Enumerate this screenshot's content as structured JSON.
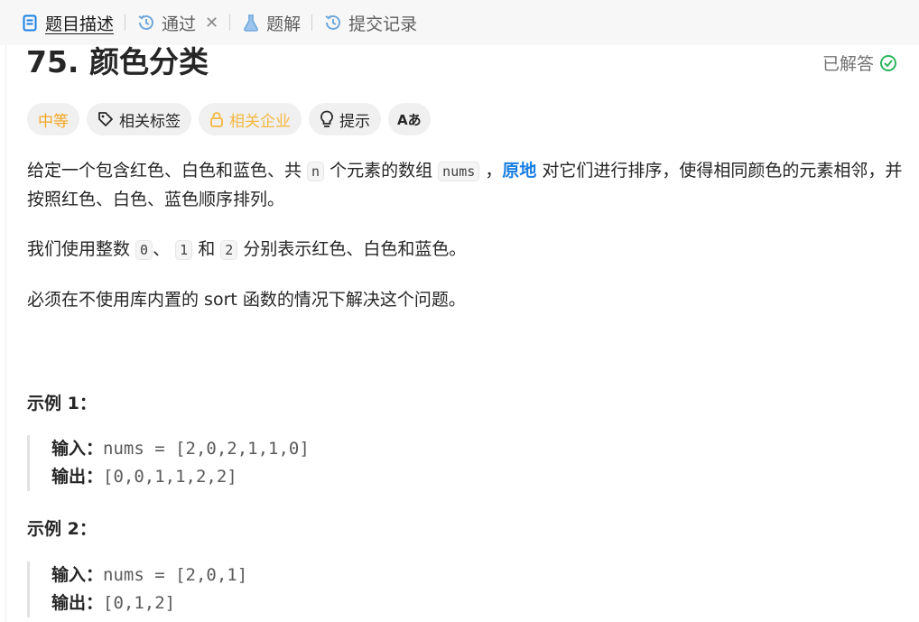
{
  "tabs": [
    {
      "label": "题目描述",
      "icon": "document-icon",
      "active": true
    },
    {
      "label": "通过",
      "icon": "history-icon",
      "closable": true
    },
    {
      "label": "题解",
      "icon": "flask-icon"
    },
    {
      "label": "提交记录",
      "icon": "history-icon"
    }
  ],
  "problem": {
    "title": "75. 颜色分类",
    "status": "已解答"
  },
  "chips": {
    "difficulty": "中等",
    "tags": "相关标签",
    "companies": "相关企业",
    "hints": "提示",
    "translate_icon": "Aあ"
  },
  "description": {
    "p1_a": "给定一个包含红色、白色和蓝色、共 ",
    "p1_code_n": "n",
    "p1_b": " 个元素的数组 ",
    "p1_code_nums": "nums",
    "p1_c": " ，",
    "p1_strong": "原地",
    "p1_d": " 对它们进行排序，使得相同颜色的元素相邻，并按照红色、白色、蓝色顺序排列。",
    "p2_a": "我们使用整数 ",
    "p2_c0": "0",
    "p2_b": "、 ",
    "p2_c1": "1",
    "p2_and": " 和 ",
    "p2_c2": "2",
    "p2_d": " 分别表示红色、白色和蓝色。",
    "p3": "必须在不使用库内置的 sort 函数的情况下解决这个问题。"
  },
  "examples": [
    {
      "title": "示例 1：",
      "input_label": "输入：",
      "input": "nums = [2,0,2,1,1,0]",
      "output_label": "输出：",
      "output": "[0,0,1,1,2,2]"
    },
    {
      "title": "示例 2：",
      "input_label": "输入：",
      "input": "nums = [2,0,1]",
      "output_label": "输出：",
      "output": "[0,1,2]"
    }
  ],
  "colors": {
    "accent": "#1a7fe3",
    "difficulty": "#f5a623",
    "solved_check": "#2db55d"
  }
}
